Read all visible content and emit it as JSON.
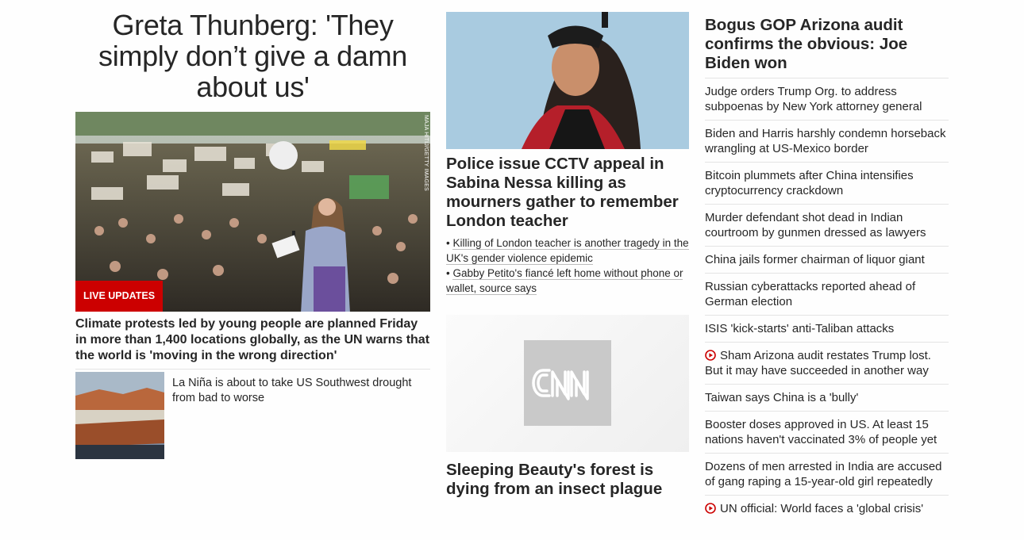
{
  "col1": {
    "headline": "Greta Thunberg: 'They simply don’t give a damn about us'",
    "photo_credit": "MAJA HITIJ/GETTY IMAGES",
    "live_badge": "LIVE UPDATES",
    "caption": "Climate protests led by young people are planned Friday in more than 1,400 locations globally, as the UN warns that the world is 'moving in the wrong direction'",
    "sub_story": "La Niña is about to take US Southwest drought from bad to worse"
  },
  "col2": {
    "headline": "Police issue CCTV appeal in Sabina Nessa killing as mourners gather to remember London teacher",
    "bullets": [
      "Killing of London teacher is another tragedy in the UK's gender violence epidemic",
      "Gabby Petito's fiancé left home without phone or wallet, source says"
    ],
    "headline2": "Sleeping Beauty's forest is dying from an insect plague"
  },
  "col3": {
    "title": "Bogus GOP Arizona audit confirms the obvious: Joe Biden won",
    "links": [
      {
        "text": "Judge orders Trump Org. to address subpoenas by New York attorney general",
        "video": false
      },
      {
        "text": "Biden and Harris harshly condemn horseback wrangling at US-Mexico border",
        "video": false
      },
      {
        "text": "Bitcoin plummets after China intensifies cryptocurrency crackdown",
        "video": false
      },
      {
        "text": "Murder defendant shot dead in Indian courtroom by gunmen dressed as lawyers",
        "video": false
      },
      {
        "text": "China jails former chairman of liquor giant",
        "video": false
      },
      {
        "text": "Russian cyberattacks reported ahead of German election",
        "video": false
      },
      {
        "text": "ISIS 'kick-starts' anti-Taliban attacks",
        "video": false
      },
      {
        "text": "Sham Arizona audit restates Trump lost. But it may have succeeded in another way",
        "video": true
      },
      {
        "text": "Taiwan says China is a 'bully'",
        "video": false
      },
      {
        "text": "Booster doses approved in US. At least 15 nations haven't vaccinated 3% of people yet",
        "video": false
      },
      {
        "text": "Dozens of men arrested in India are accused of gang raping a 15-year-old girl repeatedly",
        "video": false
      },
      {
        "text": "UN official: World faces a 'global crisis'",
        "video": true
      }
    ]
  },
  "colors": {
    "accent": "#cc0000",
    "text": "#262626",
    "divider": "#e4e4e4"
  },
  "icons": {
    "video": "play-circle-icon",
    "logo": "cnn-logo-icon"
  }
}
